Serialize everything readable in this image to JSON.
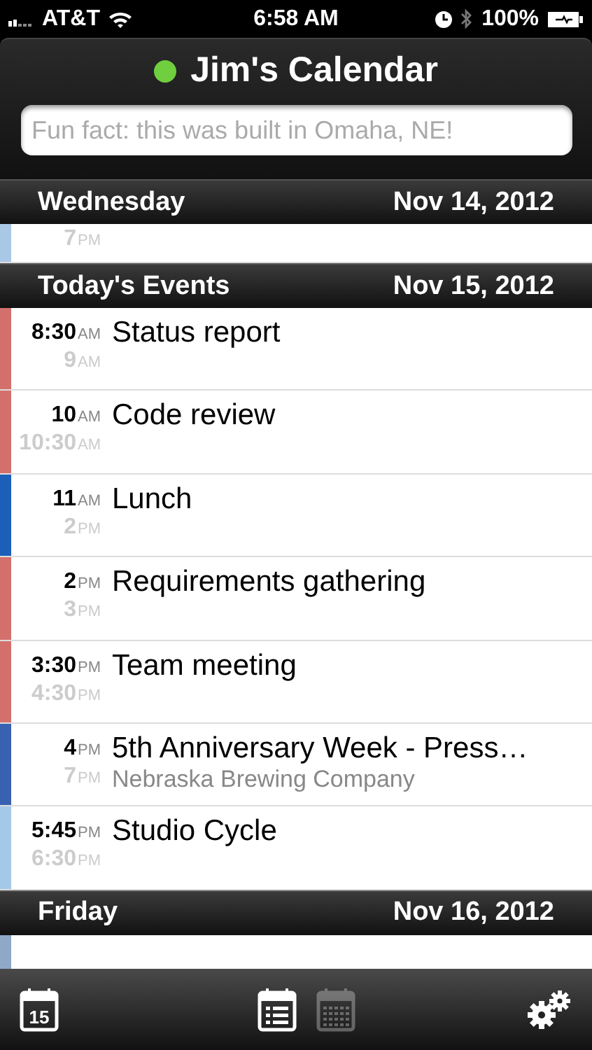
{
  "status_bar": {
    "carrier": "AT&T",
    "time": "6:58 AM",
    "battery": "100%"
  },
  "header": {
    "title": "Jim's Calendar",
    "online": true,
    "search": {
      "placeholder": "Fun fact: this was built in Omaha, NE!"
    }
  },
  "sections": [
    {
      "day": "Wednesday",
      "date": "Nov 14, 2012",
      "events": [
        {
          "kind": "tail",
          "color": "#a9c8e6",
          "end": "7",
          "end_period": "PM"
        }
      ]
    },
    {
      "day": "Today's Events",
      "date": "Nov 15, 2012",
      "events": [
        {
          "kind": "event",
          "color": "#d4706c",
          "start": "8:30",
          "start_period": "AM",
          "end": "9",
          "end_period": "AM",
          "title": "Status report"
        },
        {
          "kind": "event",
          "color": "#d4706c",
          "start": "10",
          "start_period": "AM",
          "end": "10:30",
          "end_period": "AM",
          "title": "Code review"
        },
        {
          "kind": "event",
          "color": "#1c5fb9",
          "start": "11",
          "start_period": "AM",
          "end": "2",
          "end_period": "PM",
          "title": "Lunch"
        },
        {
          "kind": "event",
          "color": "#d4706c",
          "start": "2",
          "start_period": "PM",
          "end": "3",
          "end_period": "PM",
          "title": "Requirements gathering"
        },
        {
          "kind": "event",
          "color": "#d4706c",
          "start": "3:30",
          "start_period": "PM",
          "end": "4:30",
          "end_period": "PM",
          "title": "Team meeting"
        },
        {
          "kind": "event",
          "color": "#3862b0",
          "start": "4",
          "start_period": "PM",
          "end": "7",
          "end_period": "PM",
          "title": "5th Anniversary Week - Press…",
          "location": "Nebraska Brewing Company"
        },
        {
          "kind": "event",
          "color": "#a4c8e8",
          "start": "5:45",
          "start_period": "PM",
          "end": "6:30",
          "end_period": "PM",
          "title": "Studio Cycle"
        }
      ]
    },
    {
      "day": "Friday",
      "date": "Nov 16, 2012",
      "events": [
        {
          "kind": "head",
          "color": "#8fa8c8"
        }
      ]
    }
  ],
  "toolbar": {
    "today_day": "15",
    "views": [
      {
        "kind": "list",
        "selected": true
      },
      {
        "kind": "month",
        "selected": false
      }
    ]
  }
}
